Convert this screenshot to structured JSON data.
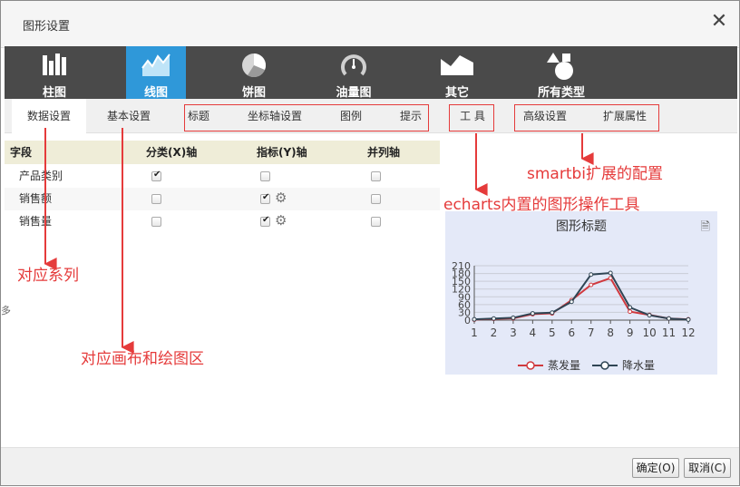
{
  "dialog": {
    "title": "图形设置",
    "close_glyph": "✕"
  },
  "types": [
    {
      "label": "柱图",
      "icon": "bar-chart-icon"
    },
    {
      "label": "线图",
      "icon": "line-chart-icon",
      "active": true
    },
    {
      "label": "饼图",
      "icon": "pie-chart-icon"
    },
    {
      "label": "油量图",
      "icon": "gauge-icon"
    },
    {
      "label": "其它",
      "icon": "area-icon"
    },
    {
      "label": "所有类型",
      "icon": "shapes-icon"
    }
  ],
  "tabs": {
    "data": "数据设置",
    "basic": "基本设置",
    "title": "标题",
    "axis": "坐标轴设置",
    "legend": "图例",
    "tooltip": "提示",
    "tools": "工 具",
    "advanced": "高级设置",
    "extended": "扩展属性"
  },
  "grid": {
    "headers": [
      "字段",
      "分类(X)轴",
      "指标(Y)轴",
      "并列轴"
    ],
    "rows": [
      {
        "field": "产品类别",
        "x": true,
        "y": false,
        "parallel": false,
        "gear": false
      },
      {
        "field": "销售额",
        "x": false,
        "y": true,
        "parallel": false,
        "gear": true
      },
      {
        "field": "销售量",
        "x": false,
        "y": true,
        "parallel": false,
        "gear": true
      }
    ]
  },
  "annotations": {
    "extension": "smartbi扩展的配置",
    "echarts_tools": "echarts内置的图形操作工具",
    "series": "对应系列",
    "canvas": "对应画布和绘图区"
  },
  "preview": {
    "title": "图形标题",
    "doc_icon": "document-icon"
  },
  "chart_data": {
    "type": "line",
    "title": "图形标题",
    "x": [
      "1",
      "2",
      "3",
      "4",
      "5",
      "6",
      "7",
      "8",
      "9",
      "10",
      "11",
      "12"
    ],
    "ylim": [
      0,
      210
    ],
    "yticks": [
      0,
      30,
      60,
      90,
      120,
      150,
      180,
      210
    ],
    "series": [
      {
        "name": "蒸发量",
        "color": "#d0393e",
        "values": [
          2,
          5,
          7,
          23,
          26,
          77,
          136,
          162,
          33,
          20,
          6,
          3
        ]
      },
      {
        "name": "降水量",
        "color": "#2f4554",
        "values": [
          3,
          6,
          9,
          26,
          29,
          71,
          176,
          182,
          49,
          19,
          6,
          2
        ]
      }
    ],
    "legend": "bottom",
    "grid": true
  },
  "footer": {
    "ok": "确定(O)",
    "cancel": "取消(C)"
  },
  "side_mark": "多"
}
